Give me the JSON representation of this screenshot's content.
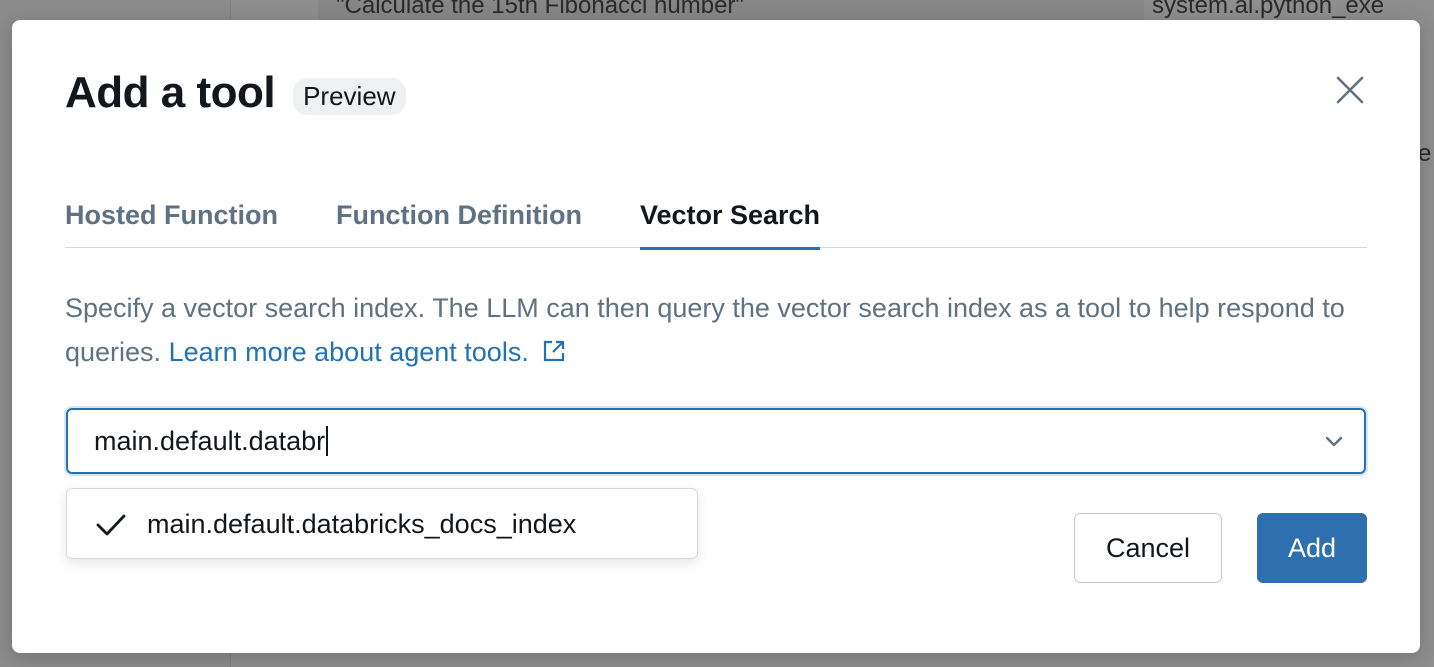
{
  "background": {
    "code_line": "\"Calculate the 15th Fibonacci number\"",
    "right_text": "system.ai.python_exe",
    "edge_text": "e"
  },
  "modal": {
    "title": "Add a tool",
    "badge": "Preview",
    "close_icon": "close-icon"
  },
  "tabs": [
    {
      "label": "Hosted Function",
      "active": false
    },
    {
      "label": "Function Definition",
      "active": false
    },
    {
      "label": "Vector Search",
      "active": true
    }
  ],
  "description": {
    "text": "Specify a vector search index. The LLM can then query the vector search index as a tool to help respond to queries.",
    "link_text": "Learn more about agent tools.",
    "link_icon": "external-link-icon"
  },
  "search": {
    "value": "main.default.databr",
    "icon": "chevron-down-icon"
  },
  "dropdown": {
    "options": [
      {
        "label": "main.default.databricks_docs_index",
        "selected": true,
        "icon": "check-icon"
      }
    ]
  },
  "footer": {
    "cancel_label": "Cancel",
    "add_label": "Add"
  },
  "colors": {
    "accent": "#2272b4",
    "primary_button": "#2e6faf",
    "text_primary": "#11171c",
    "text_secondary": "#5f7281"
  }
}
